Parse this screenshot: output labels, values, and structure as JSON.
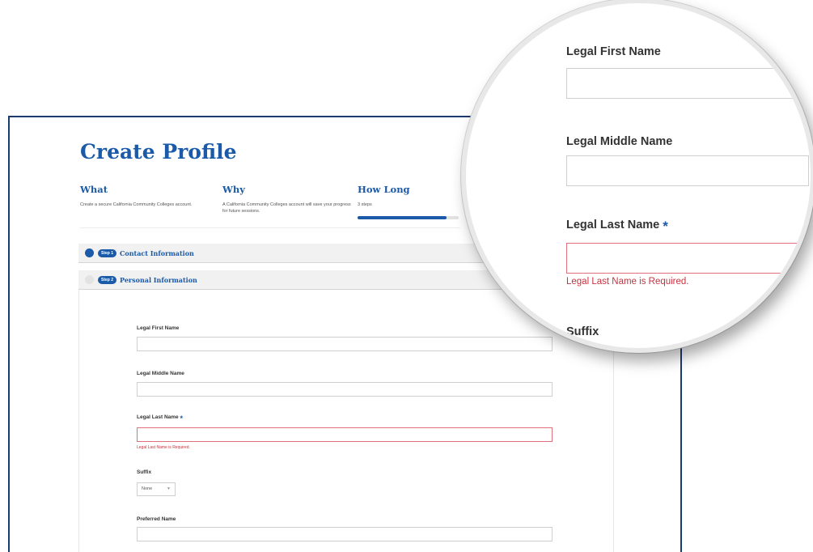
{
  "page": {
    "title": "Create Profile",
    "info": {
      "what": {
        "heading": "What",
        "text": "Create a secure California Community Colleges account."
      },
      "why": {
        "heading": "Why",
        "text": "A California Community Colleges account will save your progress for future sessions."
      },
      "how_long": {
        "heading": "How Long",
        "text": "3 steps",
        "progress_fraction": 0.88
      }
    },
    "steps": [
      {
        "pill": "Step 1",
        "label": "Contact Information",
        "dot_color": "#1a5aa8"
      },
      {
        "pill": "Step 2",
        "label": "Personal Information",
        "dot_color": "#e3e3e3"
      }
    ],
    "form": {
      "first_name_label": "Legal First Name",
      "middle_name_label": "Legal Middle Name",
      "last_name_label": "Legal Last Name",
      "required_mark": "*",
      "last_name_error": "Legal Last Name is Required.",
      "suffix_label": "Suffix",
      "suffix_value": "None",
      "preferred_name_label": "Preferred Name"
    }
  },
  "magnifier": {
    "first_name_label": "Legal First Name",
    "middle_name_label": "Legal Middle Name",
    "last_name_label": "Legal Last Name",
    "required_mark": "*",
    "last_name_error": "Legal Last Name is Required.",
    "suffix_label_partial": "Suffix"
  },
  "colors": {
    "brand_blue": "#1a5aa8",
    "frame_navy": "#1d3a6e",
    "error_red": "#c8323f"
  }
}
